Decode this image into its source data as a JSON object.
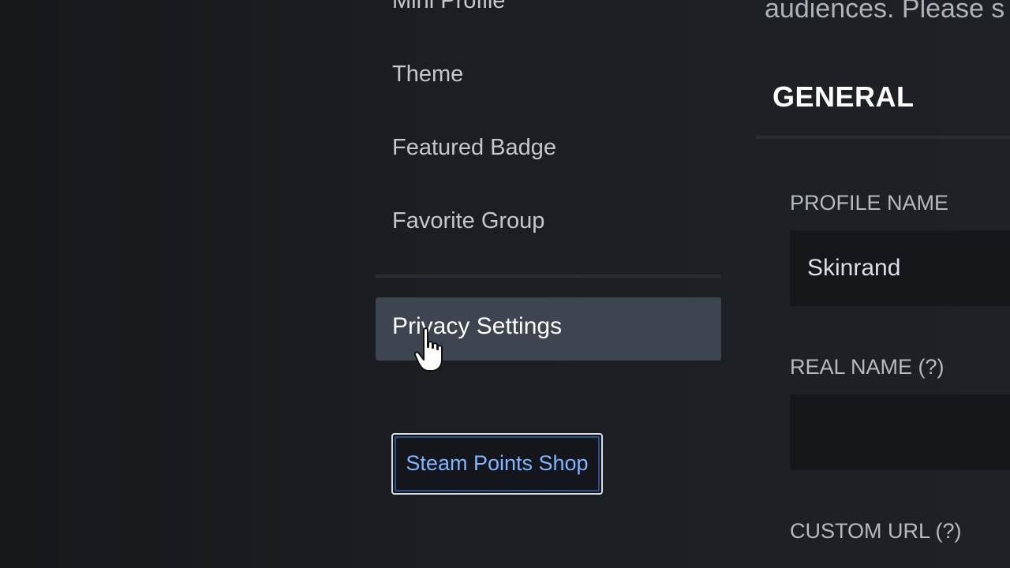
{
  "nav": {
    "items": [
      {
        "label": "Mini Profile"
      },
      {
        "label": "Theme"
      },
      {
        "label": "Featured Badge"
      },
      {
        "label": "Favorite Group"
      }
    ],
    "active_item": {
      "label": "Privacy Settings"
    },
    "points_shop_button": {
      "label": "Steam Points Shop"
    }
  },
  "content": {
    "intro_text": "audiences. Please s",
    "section_title": "GENERAL",
    "fields": {
      "profile_name": {
        "label": "PROFILE NAME",
        "value": "Skinrand"
      },
      "real_name": {
        "label": "REAL NAME (?)",
        "value": ""
      },
      "custom_url": {
        "label": "CUSTOM URL (?)"
      }
    }
  },
  "icons": {
    "cursor": "hand-pointer-icon"
  },
  "colors": {
    "background": "#1b1d21",
    "active_item_bg": "#3e4550",
    "button_text": "#7fb5ff",
    "input_bg": "#15171b"
  }
}
